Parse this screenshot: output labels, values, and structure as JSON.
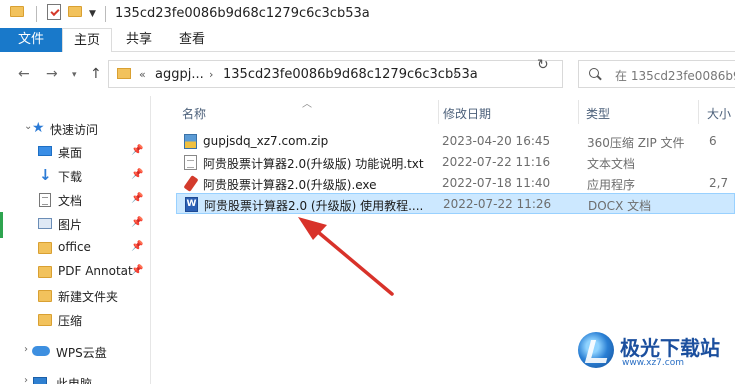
{
  "window": {
    "title": "135cd23fe0086b9d68c1279c6c3cb53a"
  },
  "ribbon": {
    "tabs": [
      "文件",
      "主页",
      "共享",
      "查看"
    ]
  },
  "address": {
    "crumbs": [
      "«",
      "aggpj...",
      "›",
      "135cd23fe0086b9d68c1279c6c3cb53a",
      "›"
    ],
    "search_placeholder": "在 135cd23fe0086b9d"
  },
  "sidebar": {
    "items": [
      {
        "label": "快速访问",
        "icon": "star-icon",
        "pinned": false
      },
      {
        "label": "桌面",
        "icon": "desktop-icon",
        "pinned": true
      },
      {
        "label": "下载",
        "icon": "download-icon",
        "pinned": true
      },
      {
        "label": "文档",
        "icon": "document-icon",
        "pinned": true
      },
      {
        "label": "图片",
        "icon": "picture-icon",
        "pinned": true
      },
      {
        "label": "office",
        "icon": "folder-icon",
        "pinned": true
      },
      {
        "label": "PDF Annotat",
        "icon": "folder-icon",
        "pinned": true
      },
      {
        "label": "新建文件夹",
        "icon": "folder-icon",
        "pinned": false
      },
      {
        "label": "压缩",
        "icon": "folder-icon",
        "pinned": false
      },
      {
        "label": "WPS云盘",
        "icon": "cloud-icon",
        "pinned": false
      },
      {
        "label": "此电脑",
        "icon": "pc-icon",
        "pinned": false
      }
    ]
  },
  "columns": {
    "name": "名称",
    "date": "修改日期",
    "type": "类型",
    "size": "大小"
  },
  "files": [
    {
      "name": "gupjsdq_xz7.com.zip",
      "date": "2023-04-20 16:45",
      "type": "360压缩 ZIP 文件",
      "size": "6",
      "icon": "zip-file-icon",
      "selected": false
    },
    {
      "name": "阿贵股票计算器2.0(升级版) 功能说明.txt",
      "date": "2022-07-22 11:16",
      "type": "文本文档",
      "size": "",
      "icon": "text-file-icon",
      "selected": false
    },
    {
      "name": "阿贵股票计算器2.0(升级版).exe",
      "date": "2022-07-18 11:40",
      "type": "应用程序",
      "size": "2,7",
      "icon": "exe-file-icon",
      "selected": false
    },
    {
      "name": "阿贵股票计算器2.0 (升级版) 使用教程....",
      "date": "2022-07-22 11:26",
      "type": "DOCX 文档",
      "size": "",
      "icon": "docx-file-icon",
      "selected": true
    }
  ],
  "watermark": {
    "text": "极光下载站",
    "sub": "www.xz7.com"
  },
  "colors": {
    "ribbon_file": "#1979ca",
    "selection": "#cce8ff",
    "arrow": "#d8322a"
  }
}
